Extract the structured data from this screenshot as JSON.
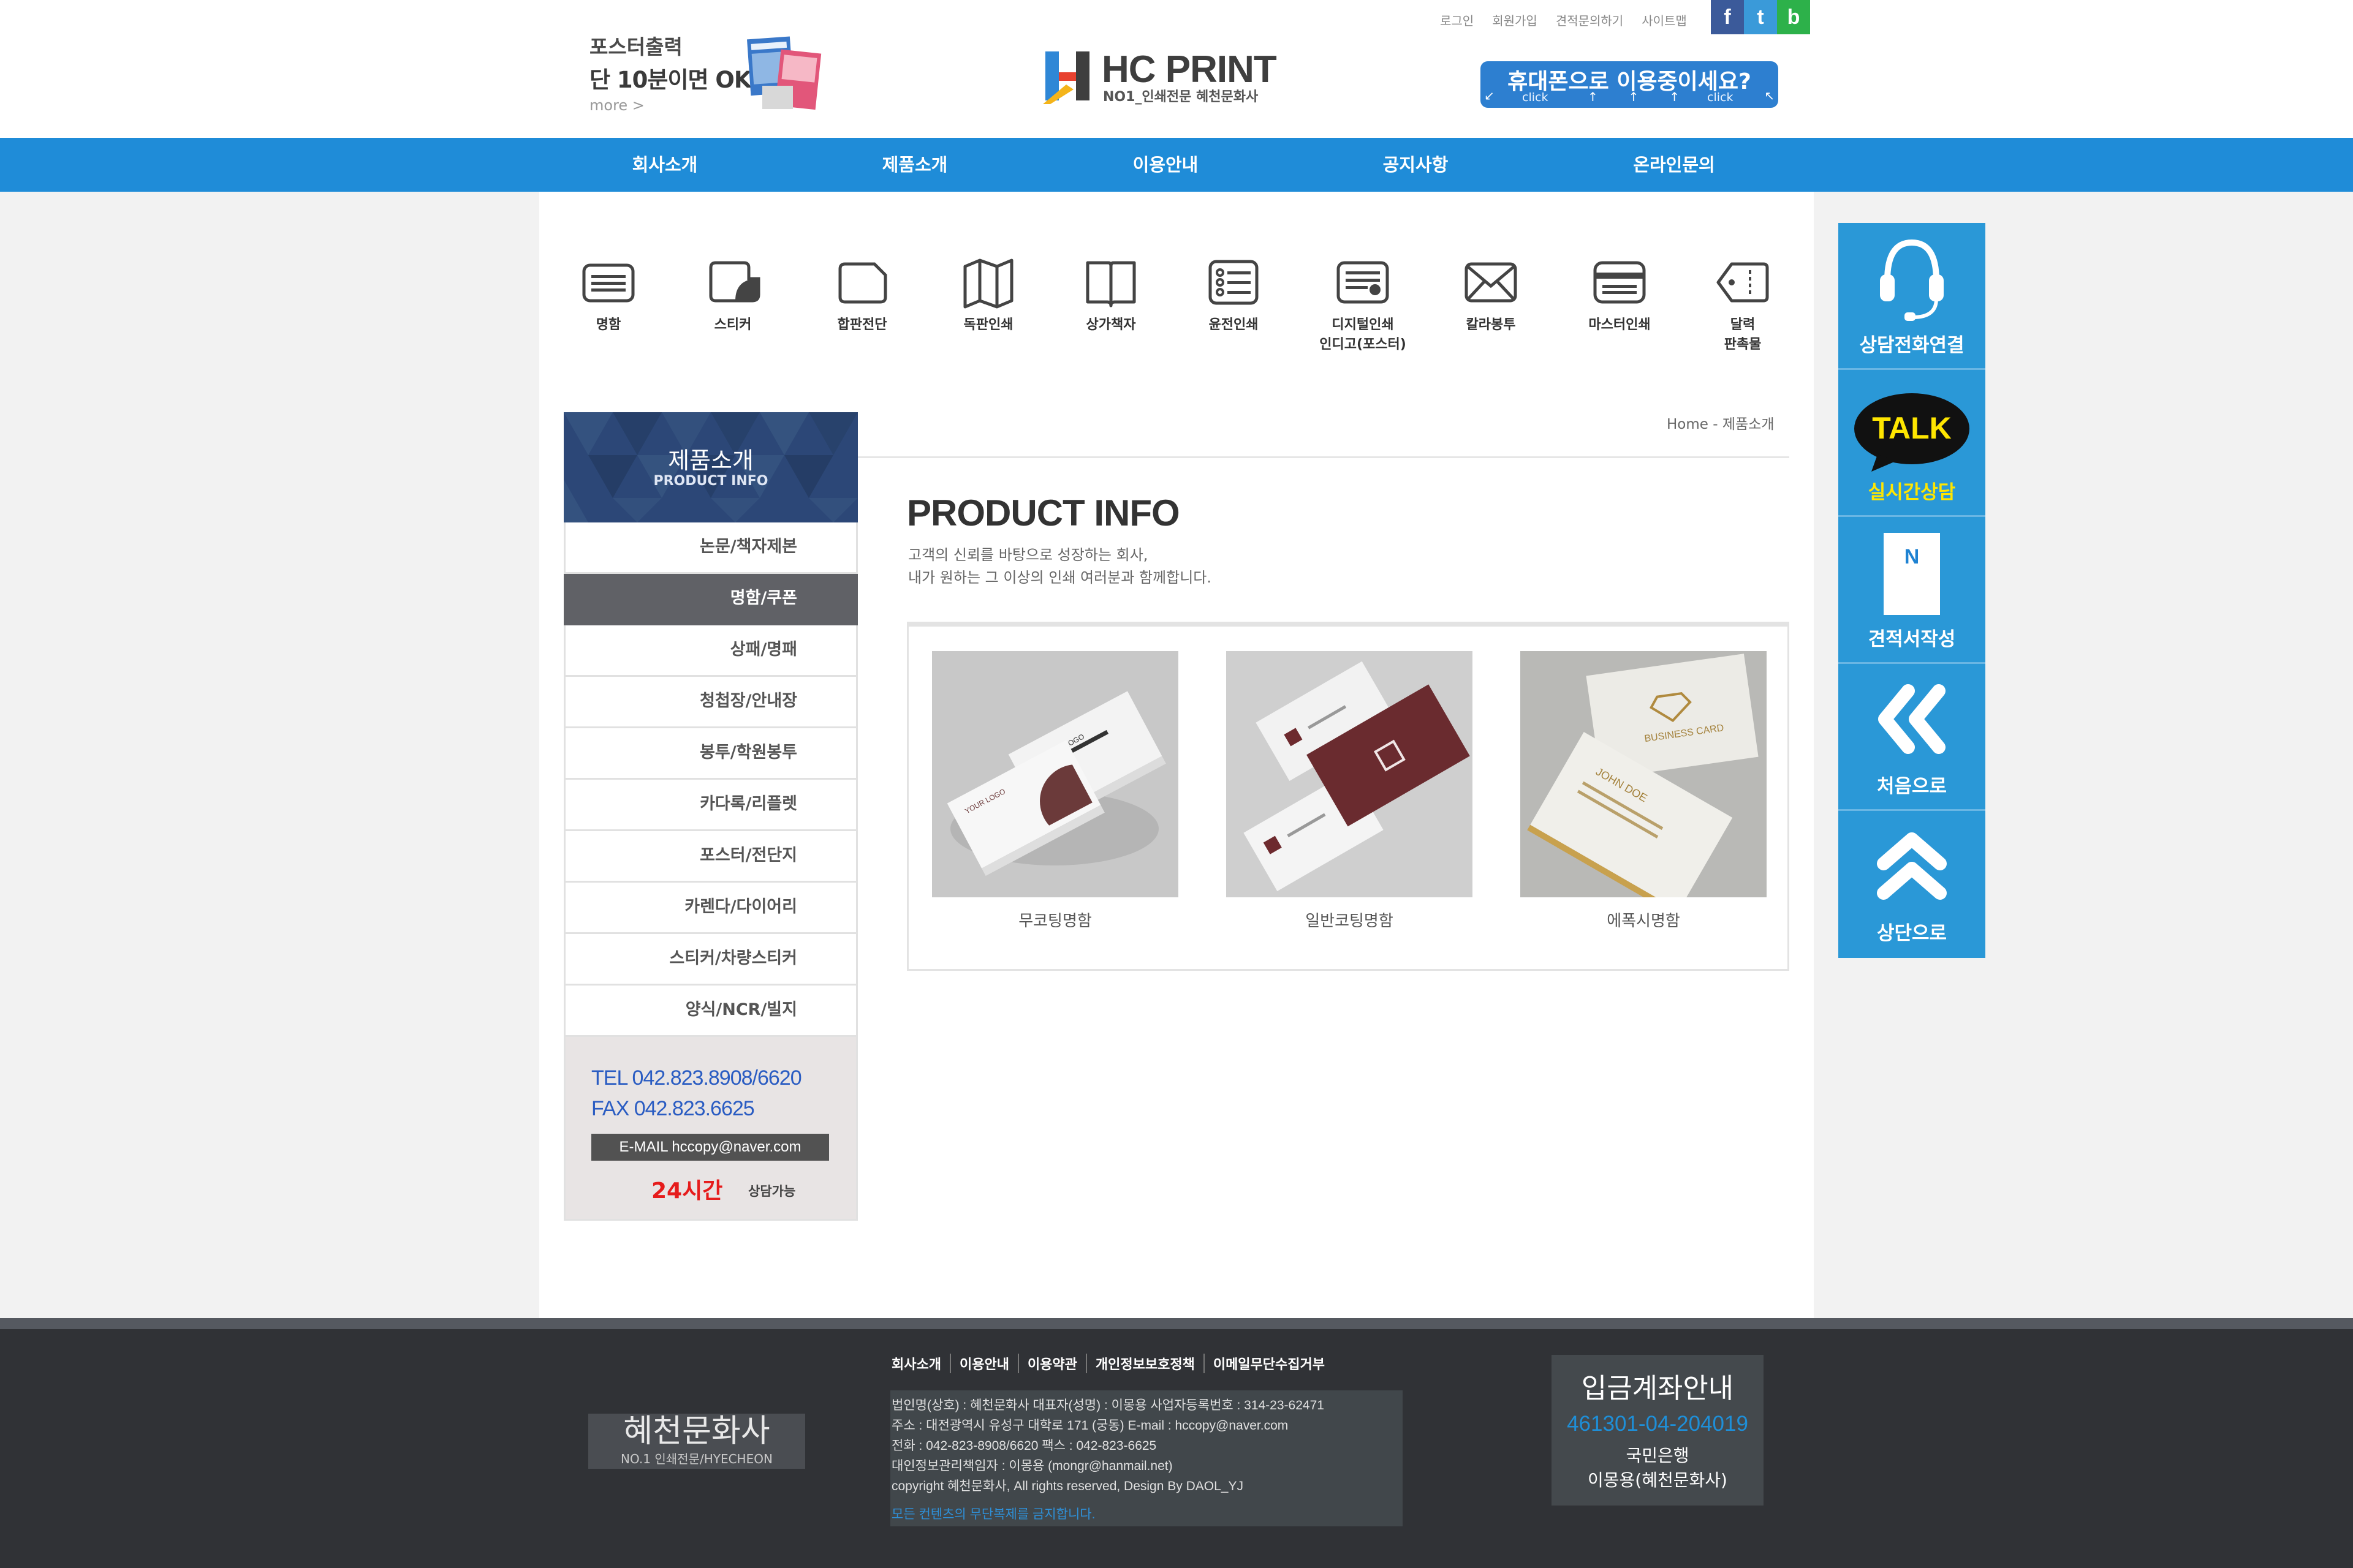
{
  "header": {
    "poster": {
      "line1": "포스터출력",
      "line2": "단 10분이면 OK!",
      "more": "more >"
    },
    "logo": {
      "title": "HC PRINT",
      "subtitle": "NO1_인쇄전문 혜천문화사"
    },
    "top_links": [
      "로그인",
      "회원가입",
      "견적문의하기",
      "사이트맵"
    ],
    "social": [
      "f",
      "t",
      "b"
    ],
    "mobile_banner": {
      "text": "휴대폰으로 이용중이세요?",
      "click_left": "click",
      "click_right": "click"
    }
  },
  "nav": [
    "회사소개",
    "제품소개",
    "이용안내",
    "공지사항",
    "온라인문의"
  ],
  "categories": [
    {
      "label": "명함",
      "icon": "business-card-icon"
    },
    {
      "label": "스티커",
      "icon": "sticker-icon"
    },
    {
      "label": "합판전단",
      "icon": "flyer-icon"
    },
    {
      "label": "독판인쇄",
      "icon": "map-fold-icon"
    },
    {
      "label": "상가책자",
      "icon": "open-book-icon"
    },
    {
      "label": "윤전인쇄",
      "icon": "rotary-print-icon"
    },
    {
      "label": "디지털인쇄\n인디고(포스터)",
      "icon": "digital-print-icon"
    },
    {
      "label": "칼라봉투",
      "icon": "envelope-icon"
    },
    {
      "label": "마스터인쇄",
      "icon": "card-stripe-icon"
    },
    {
      "label": "달력\n판촉물",
      "icon": "tag-icon"
    }
  ],
  "sidebar": {
    "title": "제품소개",
    "subtitle": "PRODUCT INFO",
    "items": [
      {
        "label": "논문/책자제본"
      },
      {
        "label": "명함/쿠폰"
      },
      {
        "label": "상패/명패"
      },
      {
        "label": "청첩장/안내장"
      },
      {
        "label": "봉투/학원봉투"
      },
      {
        "label": "카다록/리플렛"
      },
      {
        "label": "포스터/전단지"
      },
      {
        "label": "카렌다/다이어리"
      },
      {
        "label": "스티커/차량스티커"
      },
      {
        "label": "양식/NCR/빌지"
      }
    ],
    "active_index": 1,
    "contact": {
      "tel": "TEL 042.823.8908/6620",
      "fax": "FAX 042.823.6625",
      "email": "E-MAIL hccopy@naver.com",
      "hours": "24시간",
      "hours_note": "상담가능"
    }
  },
  "breadcrumb": "Home - 제품소개",
  "main": {
    "title": "PRODUCT INFO",
    "desc_line1": "고객의 신뢰를 바탕으로 성장하는 회사,",
    "desc_line2": "내가 원하는 그 이상의 인쇄 여러분과 함께합니다.",
    "products": [
      {
        "name": "무코팅명함"
      },
      {
        "name": "일반코팅명함"
      },
      {
        "name": "에폭시명함"
      }
    ],
    "card_texts": {
      "your_logo": "YOUR LOGO",
      "business_card": "BUSINESS CARD",
      "john_doe": "JOHN DOE"
    }
  },
  "quick_menu": [
    {
      "label": "상담전화연결",
      "icon": "headset-icon"
    },
    {
      "label": "실시간상담",
      "icon": "talk-bubble-icon",
      "badge": "TALK"
    },
    {
      "label": "견적서작성",
      "icon": "document-icon",
      "badge": "N"
    },
    {
      "label": "처음으로",
      "icon": "double-left-arrow-icon"
    },
    {
      "label": "상단으로",
      "icon": "double-up-arrow-icon"
    }
  ],
  "footer": {
    "logo_title": "혜천문화사",
    "logo_sub": "NO.1 인쇄전문/HYECHEON",
    "links": [
      "회사소개",
      "이용안내",
      "이용약관",
      "개인정보보호정책",
      "이메일무단수집거부"
    ],
    "info": [
      "법인명(상호) : 혜천문화사    대표자(성명) : 이몽용    사업자등록번호 : 314-23-62471",
      "주소 : 대전광역시 유성구 대학로 171 (궁동)        E-mail : hccopy@naver.com",
      "전화 : 042-823-8908/6620        팩스 : 042-823-6625",
      "대인정보관리책임자 : 이몽용 (mongr@hanmail.net)",
      "copyright 혜천문화사, All rights reserved, Design By DAOL_YJ"
    ],
    "warning": "모든 컨텐츠의 무단복제를 금지합니다.",
    "bank": {
      "title": "입금계좌안내",
      "number": "461301-04-204019",
      "name": "국민은행",
      "holder": "이몽용(혜천문화사)"
    }
  },
  "colors": {
    "nav": "#1f8cd8",
    "quick_menu": "#2a98d7",
    "sidebar_active": "#606166",
    "footer": "#303236"
  }
}
